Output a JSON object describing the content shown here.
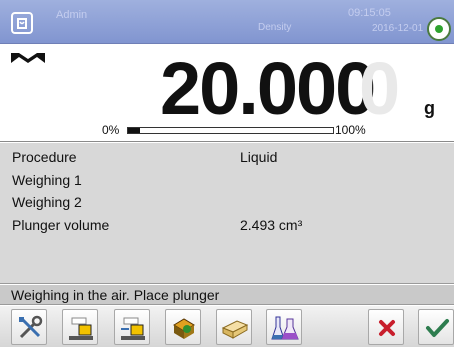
{
  "header": {
    "user": "Admin",
    "mode": "Density",
    "time": "09:15:05",
    "date": "2016-12-01"
  },
  "display": {
    "weight": "20.000",
    "weight_ghost_digit": "0",
    "unit": "g",
    "bar_min_label": "0%",
    "bar_max_label": "100%",
    "bar_fill_fraction": 0.06
  },
  "info": {
    "procedure_label": "Procedure",
    "procedure_value": "Liquid",
    "weighing1_label": "Weighing 1",
    "weighing2_label": "Weighing 2",
    "plunger_label": "Plunger volume",
    "plunger_value": "2.493 cm³"
  },
  "message": "Weighing in the air. Place plunger",
  "toolbar": {
    "icons": [
      "tools-icon",
      "weigh-in-air-icon",
      "weigh-in-liquid-icon",
      "print-icon",
      "plunger-icon",
      "liquid-density-icon",
      "cancel-icon",
      "accept-icon"
    ]
  },
  "colors": {
    "header_bg": "#8fa2d8",
    "panel_bg": "#d8d8d8",
    "accept_green": "#2e7d4f",
    "cancel_red": "#c81e2c"
  }
}
